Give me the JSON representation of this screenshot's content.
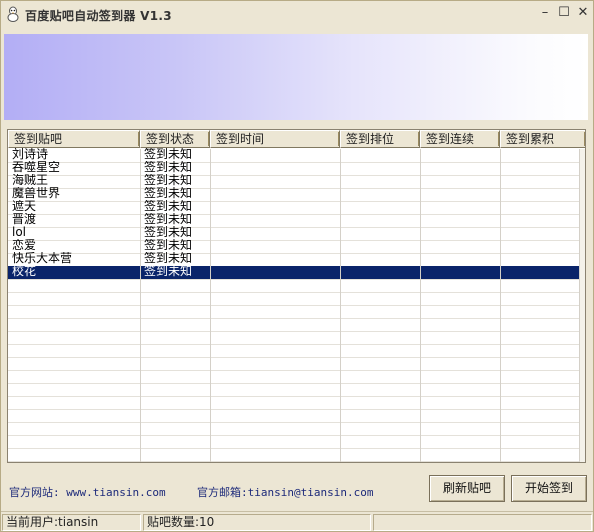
{
  "window": {
    "title": "百度贴吧自动签到器 V1.3",
    "minimize": "–",
    "maximize": "☐",
    "close": "✕"
  },
  "table": {
    "columns": [
      "签到贴吧",
      "签到状态",
      "签到时间",
      "签到排位",
      "签到连续",
      "签到累积"
    ],
    "rows": [
      [
        "刘诗诗",
        "签到未知",
        "",
        "",
        "",
        ""
      ],
      [
        "吞噬星空",
        "签到未知",
        "",
        "",
        "",
        ""
      ],
      [
        "海贼王",
        "签到未知",
        "",
        "",
        "",
        ""
      ],
      [
        "魔兽世界",
        "签到未知",
        "",
        "",
        "",
        ""
      ],
      [
        "遮天",
        "签到未知",
        "",
        "",
        "",
        ""
      ],
      [
        "晋渡",
        "签到未知",
        "",
        "",
        "",
        ""
      ],
      [
        "lol",
        "签到未知",
        "",
        "",
        "",
        ""
      ],
      [
        "恋爱",
        "签到未知",
        "",
        "",
        "",
        ""
      ],
      [
        "快乐大本营",
        "签到未知",
        "",
        "",
        "",
        ""
      ],
      [
        "校花",
        "签到未知",
        "",
        "",
        "",
        ""
      ]
    ],
    "selected_row": 9
  },
  "footer": {
    "website": "官方网站: www.tiansin.com",
    "email": "官方邮箱:tiansin@tiansin.com",
    "refresh_button": "刷新贴吧",
    "start_button": "开始签到"
  },
  "status": {
    "user": "当前用户:tiansin",
    "count": "贴吧数量:10",
    "rest": ""
  },
  "colors": {
    "selection": "#0a246a",
    "window_bg": "#ece6d4",
    "banner_start": "#b3aef5",
    "link": "#1d2a7a"
  }
}
